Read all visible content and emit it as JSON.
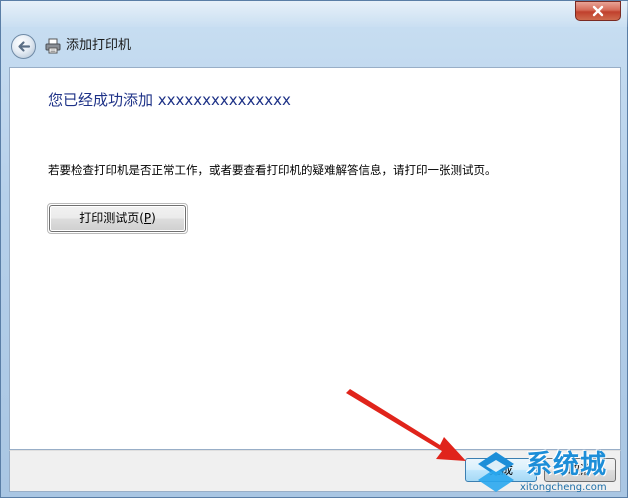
{
  "window": {
    "title": "添加打印机"
  },
  "main": {
    "heading": "您已经成功添加 xxxxxxxxxxxxxxx",
    "info": "若要检查打印机是否正常工作，或者要查看打印机的疑难解答信息，请打印一张测试页。",
    "print_test_button": {
      "label_main": "打印测试页(",
      "label_key": "P",
      "label_end": ")"
    }
  },
  "footer": {
    "finish_label": "完成",
    "cancel_label": "取消"
  },
  "watermark": {
    "brand": "系统城",
    "url": "xitongcheng.com"
  },
  "icons": {
    "close": "close-icon",
    "back": "back-arrow-icon",
    "printer": "printer-icon"
  },
  "colors": {
    "heading": "#1e3287",
    "annotation_arrow": "#e0241b",
    "watermark": "#1d8ed8"
  }
}
